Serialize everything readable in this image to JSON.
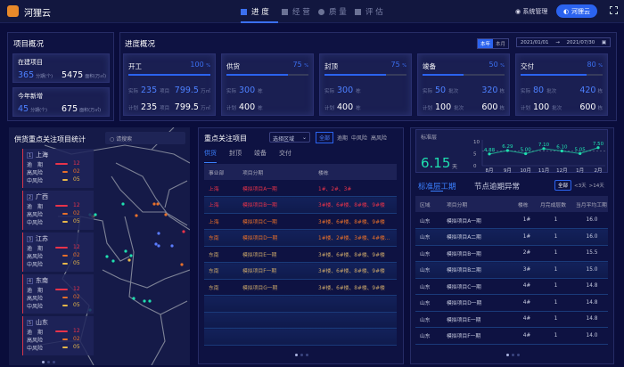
{
  "header": {
    "app_name": "河狸云",
    "nav": [
      {
        "label": "进 度",
        "icon": "progress-icon",
        "active": true
      },
      {
        "label": "经 营",
        "icon": "operation-icon"
      },
      {
        "label": "质 量",
        "icon": "quality-icon"
      },
      {
        "label": "评 估",
        "icon": "evaluate-icon"
      }
    ],
    "system": "系统管理",
    "user": "河狸云"
  },
  "overview": {
    "title": "项目概况",
    "items": [
      {
        "label": "在建项目",
        "count": "365",
        "count_unit": "分期(个)",
        "area": "5475",
        "area_unit": "面积(万㎡)"
      },
      {
        "label": "今年新增",
        "count": "45",
        "count_unit": "分期(个)",
        "area": "675",
        "area_unit": "面积(万㎡)"
      }
    ]
  },
  "progress": {
    "title": "进度概况",
    "toggle": [
      "本年",
      "本月"
    ],
    "date_from": "2021/01/01",
    "date_to": "2021/07/30",
    "arrow": "→",
    "cards": [
      {
        "name": "开工",
        "pct": 100,
        "pct_unit": "%",
        "actual_label": "实际",
        "plan_label": "计划",
        "actual": [
          [
            "235",
            "项目"
          ],
          [
            "799.5",
            "万㎡"
          ]
        ],
        "plan": [
          [
            "235",
            "项目"
          ],
          [
            "799.5",
            "万㎡"
          ]
        ]
      },
      {
        "name": "供货",
        "pct": 75,
        "pct_unit": "%",
        "actual_label": "实际",
        "plan_label": "计划",
        "actual": [
          [
            "300",
            "栋"
          ]
        ],
        "plan": [
          [
            "400",
            "栋"
          ]
        ]
      },
      {
        "name": "封顶",
        "pct": 75,
        "pct_unit": "%",
        "actual_label": "实际",
        "plan_label": "计划",
        "actual": [
          [
            "300",
            "栋"
          ]
        ],
        "plan": [
          [
            "400",
            "栋"
          ]
        ]
      },
      {
        "name": "竣备",
        "pct": 50,
        "pct_unit": "%",
        "actual_label": "实际",
        "plan_label": "计划",
        "actual": [
          [
            "50",
            "批次"
          ],
          [
            "320",
            "栋"
          ]
        ],
        "plan": [
          [
            "100",
            "批次"
          ],
          [
            "600",
            "栋"
          ]
        ]
      },
      {
        "name": "交付",
        "pct": 80,
        "pct_unit": "%",
        "actual_label": "实际",
        "plan_label": "计划",
        "actual": [
          [
            "80",
            "批次"
          ],
          [
            "420",
            "栋"
          ]
        ],
        "plan": [
          [
            "100",
            "批次"
          ],
          [
            "600",
            "栋"
          ]
        ]
      }
    ]
  },
  "supply_map": {
    "title": "供货重点关注项目统计",
    "search_placeholder": "请搜索",
    "regions": [
      {
        "no": "1",
        "name": "上海"
      },
      {
        "no": "2",
        "name": "广西"
      },
      {
        "no": "3",
        "name": "江苏"
      },
      {
        "no": "4",
        "name": "东南"
      },
      {
        "no": "5",
        "name": "山东"
      }
    ],
    "rows": [
      {
        "label": "逾　期",
        "value": "12",
        "color": "#e8334a"
      },
      {
        "label": "高风险",
        "value": "02",
        "color": "#e8702a"
      },
      {
        "label": "中风险",
        "value": "05",
        "color": "#e8b84a"
      }
    ]
  },
  "focus": {
    "title": "重点关注项目",
    "region_select": "选择区域",
    "filters": [
      "全部",
      "逾期",
      "中风险",
      "高风险"
    ],
    "tabs": [
      "供货",
      "封顶",
      "竣备",
      "交付"
    ],
    "columns": [
      "事业部",
      "项目分期",
      "楼栋"
    ],
    "rows": [
      {
        "dept": "上海",
        "project": "模拟项目A一期",
        "buildings": "1#、2#、3#",
        "color": "#e8334a"
      },
      {
        "dept": "上海",
        "project": "模拟项目B一期",
        "buildings": "3#楼、6#楼、8#楼、9#楼",
        "color": "#e8334a"
      },
      {
        "dept": "上海",
        "project": "模拟项目C一期",
        "buildings": "3#楼、6#楼、8#楼、9#楼",
        "color": "#e8702a"
      },
      {
        "dept": "东南",
        "project": "模拟项目D一期",
        "buildings": "1#楼、2#楼、3#楼、4#楼...",
        "color": "#e8702a"
      },
      {
        "dept": "东南",
        "project": "模拟项目E一期",
        "buildings": "3#楼、6#楼、8#楼、9#楼",
        "color": "#c9a56a"
      },
      {
        "dept": "东南",
        "project": "模拟项目F一期",
        "buildings": "3#楼、6#楼、8#楼、9#楼",
        "color": "#c9a56a"
      },
      {
        "dept": "东南",
        "project": "模拟项目G一期",
        "buildings": "3#楼、6#楼、8#楼、9#楼",
        "color": "#c9a56a"
      }
    ]
  },
  "standard": {
    "label": "标准层",
    "value": "6.15",
    "unit": "天",
    "tabs": [
      "标准层工期",
      "节点逾期异常"
    ],
    "filters": [
      "全部",
      "<3天",
      ">14天"
    ],
    "columns": [
      "区域",
      "项目分期",
      "楼栋",
      "月完成层数",
      "当月平均工期"
    ],
    "rows": [
      [
        "山东",
        "模拟项目A一期",
        "1#",
        "1",
        "16.0"
      ],
      [
        "山东",
        "模拟项目A二期",
        "1#",
        "1",
        "16.0"
      ],
      [
        "山东",
        "模拟项目B一期",
        "2#",
        "1",
        "15.5"
      ],
      [
        "山东",
        "模拟项目B二期",
        "3#",
        "1",
        "15.0"
      ],
      [
        "山东",
        "模拟项目C一期",
        "4#",
        "1",
        "14.8"
      ],
      [
        "山东",
        "模拟项目D一期",
        "4#",
        "1",
        "14.8"
      ],
      [
        "山东",
        "模拟项目E一期",
        "4#",
        "1",
        "14.8"
      ],
      [
        "山东",
        "模拟项目F一期",
        "4#",
        "1",
        "14.0"
      ]
    ]
  },
  "chart_data": {
    "type": "line",
    "categories": [
      "8月",
      "9月",
      "10月",
      "11月",
      "12月",
      "1月",
      "2月"
    ],
    "values": [
      4.88,
      6.29,
      5.0,
      7.1,
      6.1,
      5.05,
      7.5
    ],
    "labels": [
      "4.88",
      "6.29",
      "5.00",
      "7.10",
      "6.10",
      "5.05",
      "7.50"
    ],
    "yticks": [
      "10",
      "5",
      "0"
    ],
    "ylim": [
      0,
      10
    ],
    "reference": 6.15,
    "color": "#1fe0b0"
  }
}
